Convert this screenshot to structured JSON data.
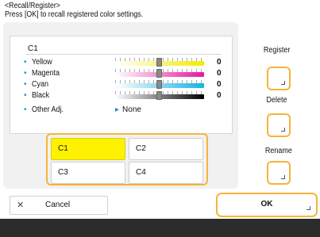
{
  "header": {
    "title": "<Recall/Register>",
    "subtitle": "Press [OK] to recall registered color settings."
  },
  "preview": {
    "title": "C1",
    "rows": [
      {
        "label": "Yellow",
        "value": "0",
        "level": 0.5,
        "color": "#f2ec00"
      },
      {
        "label": "Magenta",
        "value": "0",
        "level": 0.5,
        "color": "#e8179b"
      },
      {
        "label": "Cyan",
        "value": "0",
        "level": 0.5,
        "color": "#11b5e6"
      },
      {
        "label": "Black",
        "value": "0",
        "level": 0.5,
        "color": "#000000"
      }
    ],
    "other": {
      "label": "Other Adj.",
      "value": "None"
    }
  },
  "slots": [
    {
      "label": "C1",
      "selected": true
    },
    {
      "label": "C2",
      "selected": false
    },
    {
      "label": "C3",
      "selected": false
    },
    {
      "label": "C4",
      "selected": false
    }
  ],
  "side_buttons": {
    "register": "Register",
    "delete": "Delete",
    "rename": "Rename"
  },
  "footer": {
    "cancel": "Cancel",
    "ok": "OK"
  },
  "colors": {
    "accent": "#f6b43a",
    "selected": "#fff200",
    "bullet": "#1e8fd0"
  }
}
